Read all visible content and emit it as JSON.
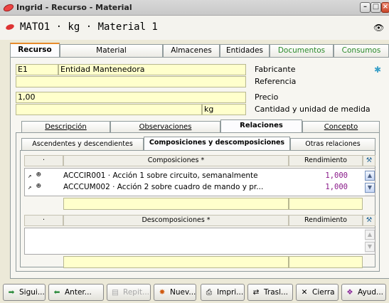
{
  "window": {
    "title": "Ingrid - Recurso - Material"
  },
  "heading": {
    "text": "MATO1 · kg · Material 1"
  },
  "top_tabs": [
    {
      "label": "Recurso"
    },
    {
      "label": "Material"
    },
    {
      "label": "Almacenes"
    },
    {
      "label": "Entidades"
    },
    {
      "label": "Documentos"
    },
    {
      "label": "Consumos"
    }
  ],
  "form": {
    "code": "E1",
    "entity": "Entidad Mantenedora",
    "fabricante_label": "Fabricante",
    "referencia_label": "Referencia",
    "precio_value": "1,00",
    "precio_label": "Precio",
    "unit_value": "kg",
    "cantidad_label": "Cantidad y unidad de medida"
  },
  "sec_tabs": [
    {
      "label": "Descripción"
    },
    {
      "label": "Observaciones"
    },
    {
      "label": "Relaciones"
    },
    {
      "label": "Concepto"
    }
  ],
  "ter_tabs": [
    {
      "label": "Ascendentes y descendientes"
    },
    {
      "label": "Composiciones y descomposiciones"
    },
    {
      "label": "Otras relaciones"
    }
  ],
  "composiciones": {
    "col_dot": "·",
    "col_name": "Composiciones *",
    "col_value": "Rendimiento",
    "rows": [
      {
        "text": "ACCCIR001 · Acción 1 sobre circuito, semanalmente",
        "value": "1,000"
      },
      {
        "text": "ACCCUM002 · Acción 2 sobre cuadro de mando y pr...",
        "value": "1,000"
      }
    ]
  },
  "descomposiciones": {
    "col_dot": "·",
    "col_name": "Descomposiciones *",
    "col_value": "Rendimiento"
  },
  "toolbar": {
    "siguiente": "Sigui...",
    "anterior": "Anter...",
    "repetir": "Repit...",
    "nuevo": "Nuev...",
    "imprimir": "Impri...",
    "trasladar": "Trasl...",
    "cierra": "Cierra",
    "ayuda": "Ayud..."
  },
  "colors": {
    "field_bg": "#ffffcc",
    "accent_tab": "#e68b2c",
    "value_purple": "#8a1a8a",
    "green_tab": "#2a8a2a"
  }
}
